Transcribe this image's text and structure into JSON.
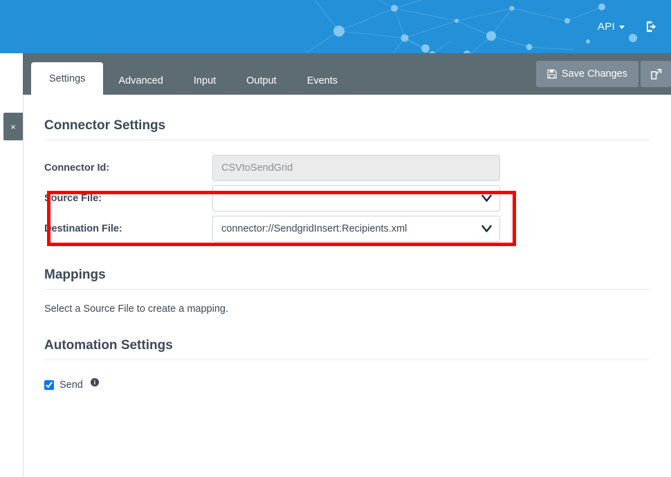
{
  "banner": {
    "api_menu_label": "API",
    "logout_icon": "logout-icon",
    "background_color": "#2390d8"
  },
  "tabs": [
    {
      "label": "Settings",
      "active": true
    },
    {
      "label": "Advanced",
      "active": false
    },
    {
      "label": "Input",
      "active": false
    },
    {
      "label": "Output",
      "active": false
    },
    {
      "label": "Events",
      "active": false
    }
  ],
  "toolbar": {
    "save_label": "Save Changes",
    "save_icon": "floppy-disk-icon",
    "open_external_icon": "external-link-icon",
    "button_color": "#7c8b96",
    "bar_color": "#5d6b73"
  },
  "close_tab": {
    "label": "×"
  },
  "sections": {
    "connector_settings": {
      "title": "Connector Settings",
      "fields": [
        {
          "label": "Connector Id:",
          "value": "CSVtoSendGrid",
          "type": "text",
          "disabled": true,
          "placeholder": ""
        },
        {
          "label": "Source File:",
          "value": "",
          "type": "select",
          "disabled": false,
          "placeholder": ""
        },
        {
          "label": "Destination File:",
          "value": "connector://SendgridInsert:Recipients.xml",
          "type": "select",
          "disabled": false,
          "placeholder": ""
        }
      ]
    },
    "mappings": {
      "title": "Mappings",
      "empty_text": "Select a Source File to create a mapping."
    },
    "automation_settings": {
      "title": "Automation Settings",
      "checkboxes": [
        {
          "label": "Send",
          "checked": true,
          "info_icon": "info-icon",
          "info_glyph": "i"
        }
      ]
    }
  },
  "annotation": {
    "type": "highlight-rectangle",
    "color": "#fb0000",
    "targets_field": "Source File:"
  }
}
